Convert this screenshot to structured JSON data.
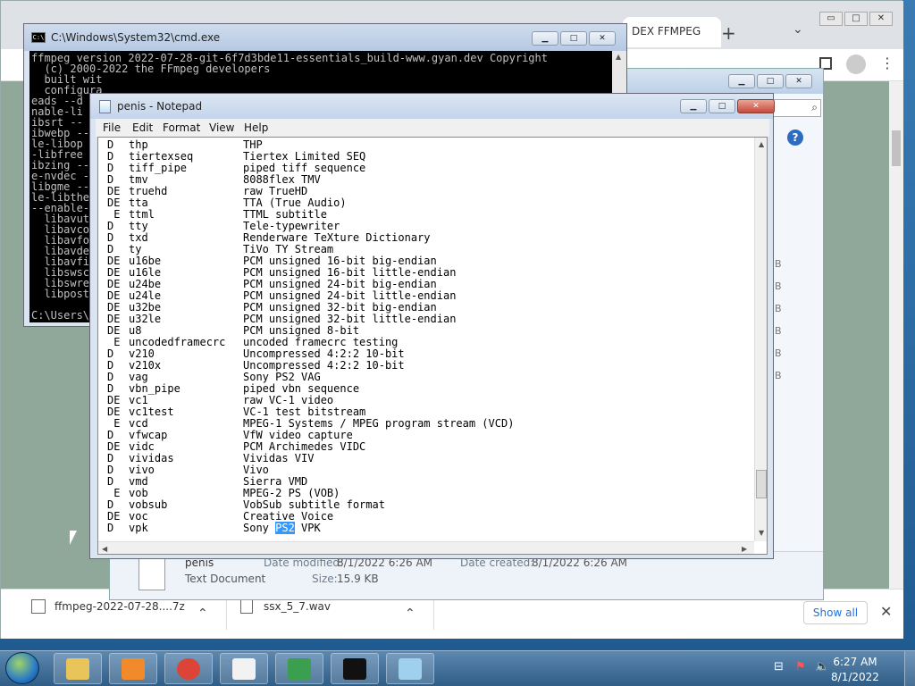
{
  "chrome": {
    "tab_label": "DEX FFMPEG",
    "new_tab": "+",
    "tab_search": "⌄",
    "controls": {
      "min": "▭",
      "max": "□",
      "close": "✕"
    },
    "downloads": [
      {
        "name": "ffmpeg-2022-07-28....7z",
        "chevron": "⌃"
      },
      {
        "name": "ssx_5_7.wav",
        "chevron": "⌃"
      }
    ],
    "show_all": "Show all",
    "close_bar": "✕"
  },
  "explorer": {
    "file_name": "penis",
    "file_type": "Text Document",
    "date_modified_label": "Date modified:",
    "date_modified": "8/1/2022 6:26 AM",
    "date_created_label": "Date created:",
    "date_created": "8/1/2022 6:26 AM",
    "size_label": "Size:",
    "size": "15.9 KB",
    "size_col": [
      "B",
      "B",
      "B",
      "B",
      "B",
      "B"
    ]
  },
  "cmd": {
    "title": "C:\\Windows\\System32\\cmd.exe",
    "icon": "C:\\",
    "lines": [
      "ffmpeg version 2022-07-28-git-6f7d3bde11-essentials_build-www.gyan.dev Copyright",
      "  (c) 2000-2022 the FFmpeg developers",
      "  built wit",
      "  configura",
      "eads --d",
      "nable-li",
      "ibsrt --",
      "ibwebp --",
      "le-libop",
      "-libfree",
      "ibzing --",
      "e-nvdec -",
      "libgme --",
      "le-libthe",
      "--enable-",
      "  libavut",
      "  libavco",
      "  libavfo",
      "  libavde",
      "  libavfi",
      "  libswsc",
      "  libswre",
      "  libpost",
      "",
      "C:\\Users\\"
    ]
  },
  "notepad": {
    "title": "penis - Notepad",
    "menu": [
      "File",
      "Edit",
      "Format",
      "View",
      "Help"
    ],
    "rows": [
      {
        "flag": "D ",
        "name": "thp",
        "desc": "THP"
      },
      {
        "flag": "D ",
        "name": "tiertexseq",
        "desc": "Tiertex Limited SEQ"
      },
      {
        "flag": "D ",
        "name": "tiff_pipe",
        "desc": "piped tiff sequence"
      },
      {
        "flag": "D ",
        "name": "tmv",
        "desc": "8088flex TMV"
      },
      {
        "flag": "DE",
        "name": "truehd",
        "desc": "raw TrueHD"
      },
      {
        "flag": "DE",
        "name": "tta",
        "desc": "TTA (True Audio)"
      },
      {
        "flag": " E",
        "name": "ttml",
        "desc": "TTML subtitle"
      },
      {
        "flag": "D ",
        "name": "tty",
        "desc": "Tele-typewriter"
      },
      {
        "flag": "D ",
        "name": "txd",
        "desc": "Renderware TeXture Dictionary"
      },
      {
        "flag": "D ",
        "name": "ty",
        "desc": "TiVo TY Stream"
      },
      {
        "flag": "DE",
        "name": "u16be",
        "desc": "PCM unsigned 16-bit big-endian"
      },
      {
        "flag": "DE",
        "name": "u16le",
        "desc": "PCM unsigned 16-bit little-endian"
      },
      {
        "flag": "DE",
        "name": "u24be",
        "desc": "PCM unsigned 24-bit big-endian"
      },
      {
        "flag": "DE",
        "name": "u24le",
        "desc": "PCM unsigned 24-bit little-endian"
      },
      {
        "flag": "DE",
        "name": "u32be",
        "desc": "PCM unsigned 32-bit big-endian"
      },
      {
        "flag": "DE",
        "name": "u32le",
        "desc": "PCM unsigned 32-bit little-endian"
      },
      {
        "flag": "DE",
        "name": "u8",
        "desc": "PCM unsigned 8-bit"
      },
      {
        "flag": " E",
        "name": "uncodedframecrc",
        "desc": "uncoded framecrc testing"
      },
      {
        "flag": "D ",
        "name": "v210",
        "desc": "Uncompressed 4:2:2 10-bit"
      },
      {
        "flag": "D ",
        "name": "v210x",
        "desc": "Uncompressed 4:2:2 10-bit"
      },
      {
        "flag": "D ",
        "name": "vag",
        "desc": "Sony PS2 VAG"
      },
      {
        "flag": "D ",
        "name": "vbn_pipe",
        "desc": "piped vbn sequence"
      },
      {
        "flag": "DE",
        "name": "vc1",
        "desc": "raw VC-1 video"
      },
      {
        "flag": "DE",
        "name": "vc1test",
        "desc": "VC-1 test bitstream"
      },
      {
        "flag": " E",
        "name": "vcd",
        "desc": "MPEG-1 Systems / MPEG program stream (VCD)"
      },
      {
        "flag": "D ",
        "name": "vfwcap",
        "desc": "VfW video capture"
      },
      {
        "flag": "DE",
        "name": "vidc",
        "desc": "PCM Archimedes VIDC"
      },
      {
        "flag": "D ",
        "name": "vividas",
        "desc": "Vividas VIV"
      },
      {
        "flag": "D ",
        "name": "vivo",
        "desc": "Vivo"
      },
      {
        "flag": "D ",
        "name": "vmd",
        "desc": "Sierra VMD"
      },
      {
        "flag": " E",
        "name": "vob",
        "desc": "MPEG-2 PS (VOB)"
      },
      {
        "flag": "D ",
        "name": "vobsub",
        "desc": "VobSub subtitle format"
      },
      {
        "flag": "DE",
        "name": "voc",
        "desc": "Creative Voice"
      }
    ],
    "last_row": {
      "flag": "D ",
      "name": "vpk",
      "desc_pre": "Sony ",
      "desc_sel": "PS2",
      "desc_post": " VPK"
    }
  },
  "taskbar": {
    "time": "6:27 AM",
    "date": "8/1/2022",
    "apps": [
      {
        "name": "explorer",
        "color": "#e8c45a"
      },
      {
        "name": "media-player",
        "color": "#f08a2a"
      },
      {
        "name": "chrome",
        "color": "#db4437"
      },
      {
        "name": "7-zip",
        "color": "#f2f2f2"
      },
      {
        "name": "installer",
        "color": "#3aa050"
      },
      {
        "name": "cmd",
        "color": "#111111"
      },
      {
        "name": "notepad",
        "color": "#9fd0ee"
      }
    ]
  }
}
